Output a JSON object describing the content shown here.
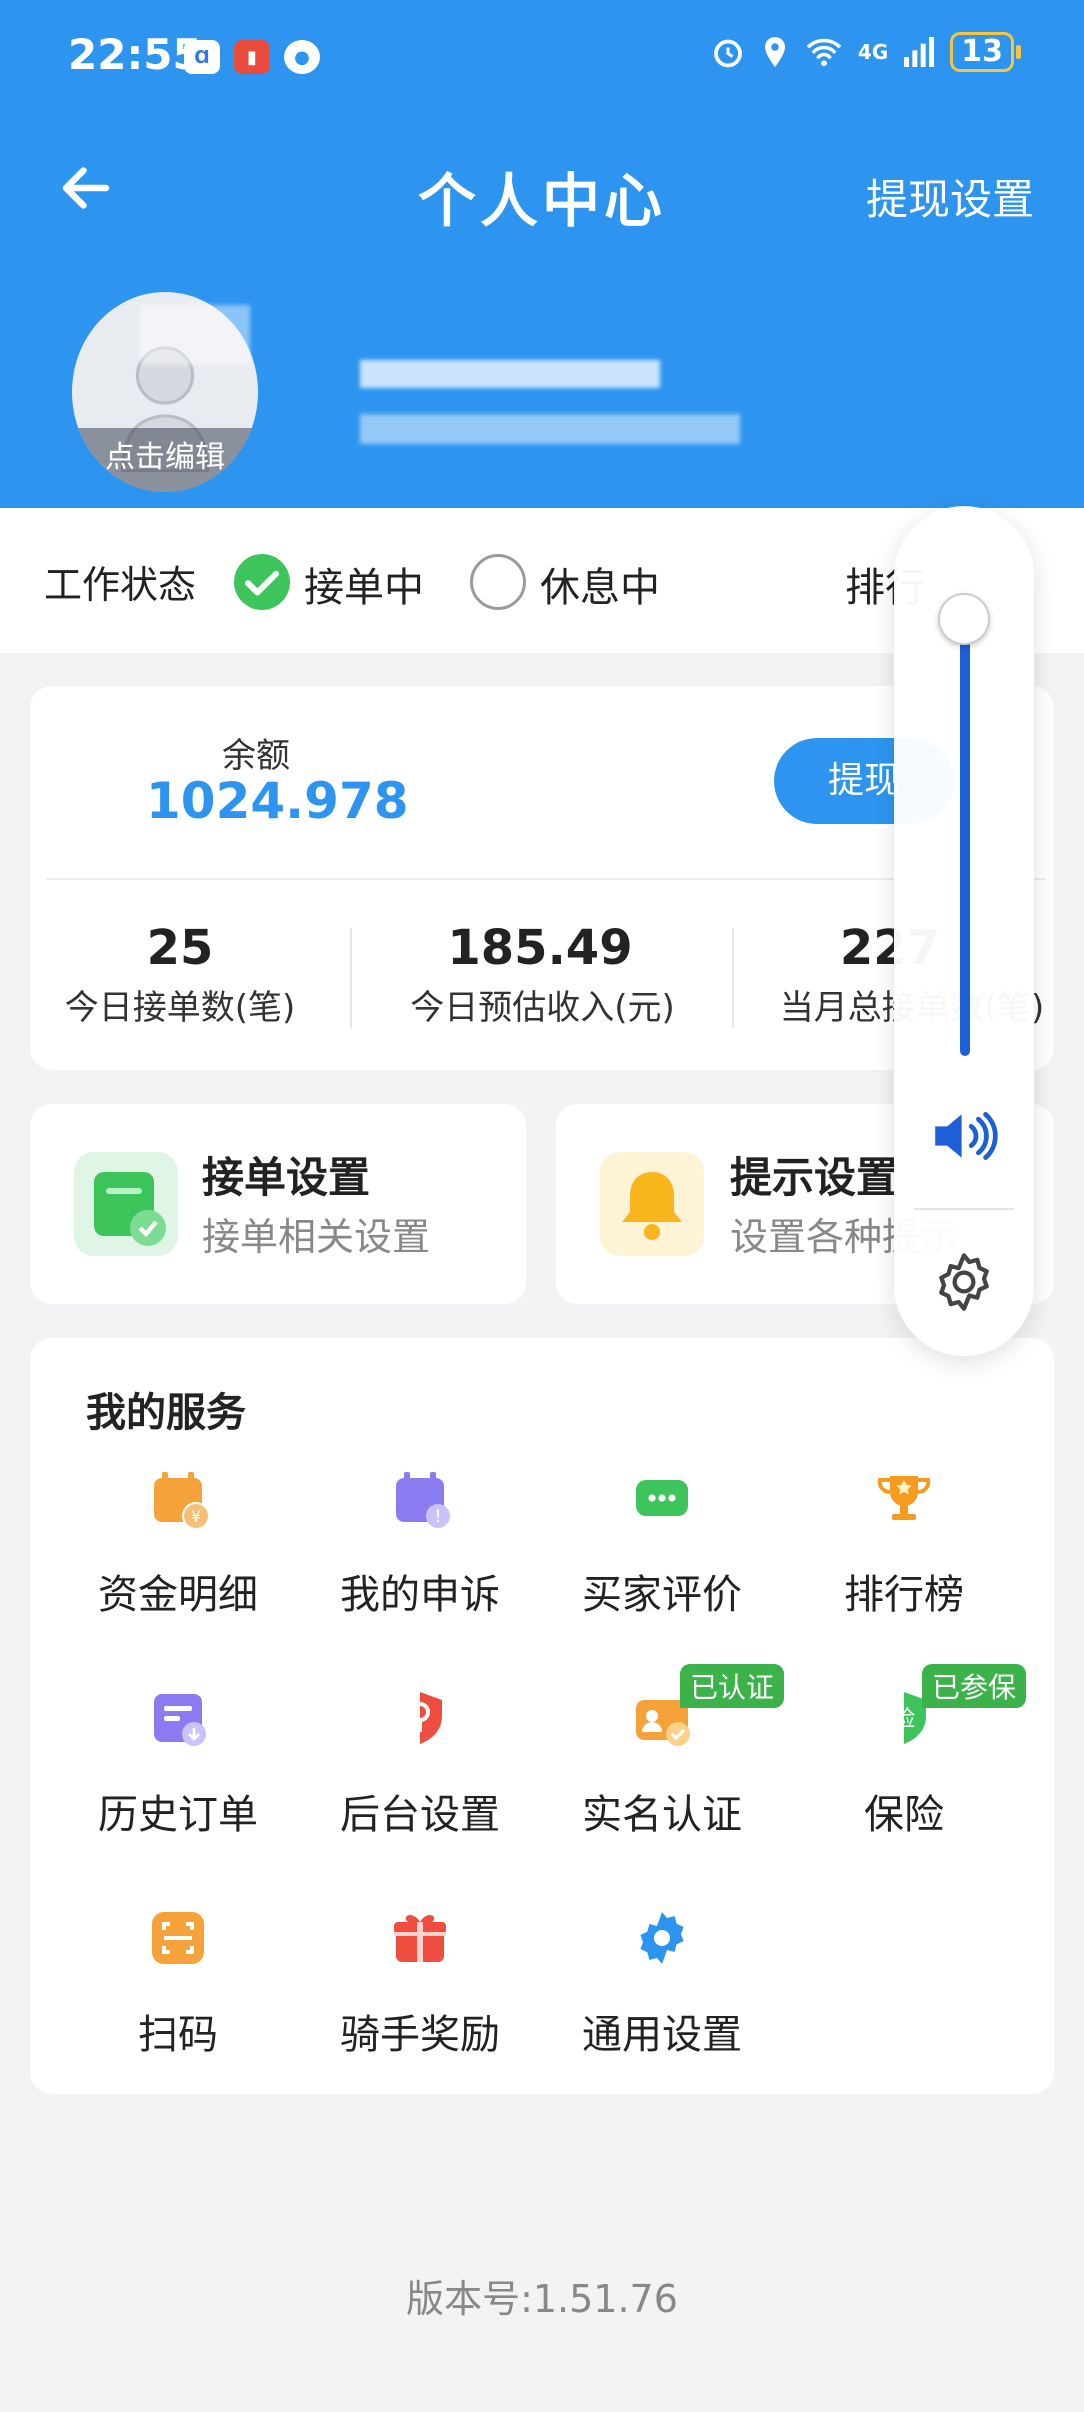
{
  "status_bar": {
    "time": "22:55",
    "battery": "13",
    "network": "4G"
  },
  "header": {
    "title": "个人中心",
    "right_action": "提现设置",
    "avatar_label": "点击编辑"
  },
  "work_status": {
    "label": "工作状态",
    "options": [
      {
        "label": "接单中",
        "selected": true
      },
      {
        "label": "休息中",
        "selected": false
      }
    ],
    "rank_label": "排行"
  },
  "balance": {
    "label": "余额",
    "value": "1024.978",
    "withdraw_button": "提现"
  },
  "stats": [
    {
      "value": "25",
      "label": "今日接单数(笔)"
    },
    {
      "value": "185.49",
      "label": "今日预估收入(元)"
    },
    {
      "value": "227",
      "label": "当月总接单数(笔)"
    }
  ],
  "settings_cards": [
    {
      "title": "接单设置",
      "subtitle": "接单相关设置",
      "icon": "order-settings-icon"
    },
    {
      "title": "提示设置",
      "subtitle": "设置各种提示",
      "icon": "bell-icon"
    }
  ],
  "services": {
    "title": "我的服务",
    "items": [
      {
        "label": "资金明细",
        "icon": "fund-detail-icon",
        "color": "#f5a23a"
      },
      {
        "label": "我的申诉",
        "icon": "appeal-icon",
        "color": "#8a7cf0"
      },
      {
        "label": "买家评价",
        "icon": "chat-icon",
        "color": "#3dc55c"
      },
      {
        "label": "排行榜",
        "icon": "trophy-icon",
        "color": "#f59b1e"
      },
      {
        "label": "历史订单",
        "icon": "history-order-icon",
        "color": "#8a7cf0"
      },
      {
        "label": "后台设置",
        "icon": "location-shield-icon",
        "color": "#ee4d3f"
      },
      {
        "label": "实名认证",
        "icon": "id-verify-icon",
        "color": "#f5a23a",
        "badge": "已认证"
      },
      {
        "label": "保险",
        "icon": "insurance-shield-icon",
        "color": "#3dc55c",
        "badge": "已参保",
        "glyph": "险"
      },
      {
        "label": "扫码",
        "icon": "scan-icon",
        "color": "#f5a23a"
      },
      {
        "label": "骑手奖励",
        "icon": "gift-icon",
        "color": "#ee4d3f"
      },
      {
        "label": "通用设置",
        "icon": "gear-icon",
        "color": "#2d95f0"
      }
    ]
  },
  "version": "版本号:1.51.76",
  "volume": {
    "level": 0.95
  }
}
